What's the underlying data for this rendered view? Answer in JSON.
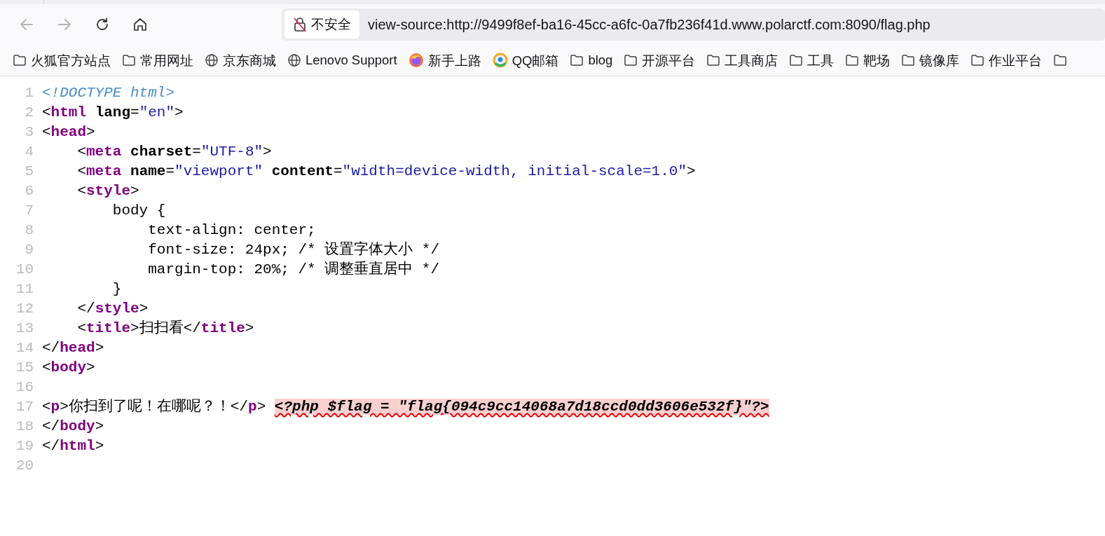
{
  "toolbar": {
    "back": {
      "disabled": true
    },
    "forward": {
      "disabled": true
    }
  },
  "address_bar": {
    "security_label": "不安全",
    "url": "view-source:http://9499f8ef-ba16-45cc-a6fc-0a7fb236f41d.www.polarctf.com:8090/flag.php"
  },
  "bookmarks": [
    {
      "kind": "folder",
      "label": "火狐官方站点"
    },
    {
      "kind": "folder",
      "label": "常用网址"
    },
    {
      "kind": "globe",
      "label": "京东商城"
    },
    {
      "kind": "globe",
      "label": "Lenovo Support"
    },
    {
      "kind": "firefox",
      "label": "新手上路"
    },
    {
      "kind": "qq",
      "label": "QQ邮箱"
    },
    {
      "kind": "folder",
      "label": "blog"
    },
    {
      "kind": "folder",
      "label": "开源平台"
    },
    {
      "kind": "folder",
      "label": "工具商店"
    },
    {
      "kind": "folder",
      "label": "工具"
    },
    {
      "kind": "folder",
      "label": "靶场"
    },
    {
      "kind": "folder",
      "label": "镜像库"
    },
    {
      "kind": "folder",
      "label": "作业平台"
    },
    {
      "kind": "folder"
    }
  ],
  "source_lines": [
    {
      "number": "1",
      "segments": [
        {
          "kind": "doctype",
          "text": "<!DOCTYPE html>"
        }
      ]
    },
    {
      "number": "2",
      "segments": [
        {
          "kind": "punct",
          "text": "<"
        },
        {
          "kind": "tag",
          "text": "html"
        },
        {
          "kind": "attr",
          "text": " lang"
        },
        {
          "kind": "punct",
          "text": "="
        },
        {
          "kind": "value",
          "text": "\"en\""
        },
        {
          "kind": "punct",
          "text": ">"
        }
      ]
    },
    {
      "number": "3",
      "segments": [
        {
          "kind": "punct",
          "text": "<"
        },
        {
          "kind": "tag",
          "text": "head"
        },
        {
          "kind": "punct",
          "text": ">"
        }
      ]
    },
    {
      "number": "4",
      "segments": [
        {
          "kind": "punct",
          "text": "    <"
        },
        {
          "kind": "tag",
          "text": "meta"
        },
        {
          "kind": "attr",
          "text": " charset"
        },
        {
          "kind": "punct",
          "text": "="
        },
        {
          "kind": "value",
          "text": "\"UTF-8\""
        },
        {
          "kind": "punct",
          "text": ">"
        }
      ]
    },
    {
      "number": "5",
      "segments": [
        {
          "kind": "punct",
          "text": "    <"
        },
        {
          "kind": "tag",
          "text": "meta"
        },
        {
          "kind": "attr",
          "text": " name"
        },
        {
          "kind": "punct",
          "text": "="
        },
        {
          "kind": "value",
          "text": "\"viewport\""
        },
        {
          "kind": "attr",
          "text": " content"
        },
        {
          "kind": "punct",
          "text": "="
        },
        {
          "kind": "value",
          "text": "\"width=device-width, initial-scale=1.0\""
        },
        {
          "kind": "punct",
          "text": ">"
        }
      ]
    },
    {
      "number": "6",
      "segments": [
        {
          "kind": "punct",
          "text": "    <"
        },
        {
          "kind": "tag",
          "text": "style"
        },
        {
          "kind": "punct",
          "text": ">"
        }
      ]
    },
    {
      "number": "7",
      "segments": [
        {
          "kind": "text",
          "text": "        body {"
        }
      ]
    },
    {
      "number": "8",
      "segments": [
        {
          "kind": "text",
          "text": "            text-align: center;"
        }
      ]
    },
    {
      "number": "9",
      "segments": [
        {
          "kind": "text",
          "text": "            font-size: 24px; /* 设置字体大小 */"
        }
      ]
    },
    {
      "number": "10",
      "segments": [
        {
          "kind": "text",
          "text": "            margin-top: 20%; /* 调整垂直居中 */"
        }
      ]
    },
    {
      "number": "11",
      "segments": [
        {
          "kind": "text",
          "text": "        }"
        }
      ]
    },
    {
      "number": "12",
      "segments": [
        {
          "kind": "punct",
          "text": "    </"
        },
        {
          "kind": "tag",
          "text": "style"
        },
        {
          "kind": "punct",
          "text": ">"
        }
      ]
    },
    {
      "number": "13",
      "segments": [
        {
          "kind": "punct",
          "text": "    <"
        },
        {
          "kind": "tag",
          "text": "title"
        },
        {
          "kind": "punct",
          "text": ">扫扫看</"
        },
        {
          "kind": "tag",
          "text": "title"
        },
        {
          "kind": "punct",
          "text": ">"
        }
      ]
    },
    {
      "number": "14",
      "segments": [
        {
          "kind": "punct",
          "text": "</"
        },
        {
          "kind": "tag",
          "text": "head"
        },
        {
          "kind": "punct",
          "text": ">"
        }
      ]
    },
    {
      "number": "15",
      "segments": [
        {
          "kind": "punct",
          "text": "<"
        },
        {
          "kind": "tag",
          "text": "body"
        },
        {
          "kind": "punct",
          "text": ">"
        }
      ]
    },
    {
      "number": "16"
    },
    {
      "number": "17",
      "segments": [
        {
          "kind": "punct",
          "text": "<"
        },
        {
          "kind": "tag",
          "text": "p"
        },
        {
          "kind": "punct",
          "text": ">你扫到了呢！在哪呢？！</"
        },
        {
          "kind": "tag",
          "text": "p"
        },
        {
          "kind": "punct",
          "text": "> "
        },
        {
          "kind": "error",
          "text": "<?php $flag = \"flag{094c9cc14068a7d18ccd0dd3606e532f}\"?>"
        }
      ]
    },
    {
      "number": "18",
      "segments": [
        {
          "kind": "punct",
          "text": "</"
        },
        {
          "kind": "tag",
          "text": "body"
        },
        {
          "kind": "punct",
          "text": ">"
        }
      ]
    },
    {
      "number": "19",
      "segments": [
        {
          "kind": "punct",
          "text": "</"
        },
        {
          "kind": "tag",
          "text": "html"
        },
        {
          "kind": "punct",
          "text": ">"
        }
      ]
    },
    {
      "number": "20"
    }
  ]
}
